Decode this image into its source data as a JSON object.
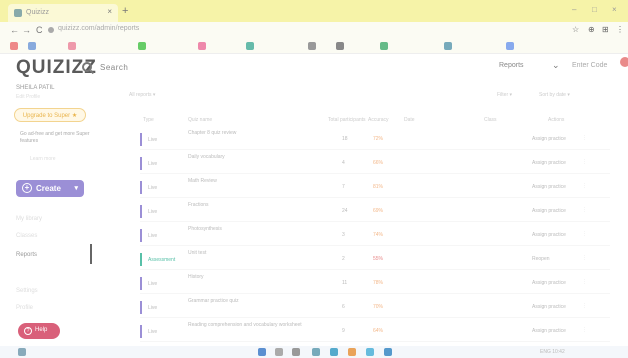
{
  "browser": {
    "tab_title": "Quizizz",
    "tab_close": "×",
    "new_tab": "+",
    "window_controls": [
      "–",
      "□",
      "×"
    ],
    "nav": {
      "back": "←",
      "forward": "→",
      "reload": "C"
    },
    "url": "quizizz.com/admin/reports",
    "address_icons": [
      "☆",
      "⊕",
      "⊞",
      "⋮"
    ]
  },
  "header": {
    "logo": "QUIZIZZ",
    "search_label": "Search",
    "reports_label": "Reports",
    "chevron": "⌄",
    "enter_code": "Enter Code"
  },
  "sidebar": {
    "user_name": "SHEILA PATIL",
    "user_sub": "Edit Profile",
    "upgrade_label": "Upgrade to Super ★",
    "promo_text": "Go ad-free and get more Super features",
    "promo_link": "Learn more",
    "create_label": "Create",
    "create_plus": "+",
    "create_caret": "▾",
    "items": [
      {
        "label": "My library"
      },
      {
        "label": "Classes"
      },
      {
        "label": "Reports"
      },
      {
        "label": "Settings"
      },
      {
        "label": "Profile"
      }
    ],
    "help_label": "Help",
    "help_icon": "?"
  },
  "main": {
    "filter_label": "All reports ▾",
    "filter_right": "Filter ▾",
    "filter_right2": "Sort by date ▾",
    "headers": [
      "Type",
      "Quiz name",
      "Total participants",
      "Accuracy",
      "Date",
      "Class",
      "Actions"
    ],
    "rows": [
      {
        "type": "Live",
        "name": "Chapter 8 quiz review",
        "num": "18",
        "acc": "72%",
        "action": "Assign practice"
      },
      {
        "type": "Live",
        "name": "Daily vocabulary",
        "num": "4",
        "acc": "66%",
        "action": "Assign practice"
      },
      {
        "type": "Live",
        "name": "Math Review",
        "num": "7",
        "acc": "81%",
        "action": "Assign practice"
      },
      {
        "type": "Live",
        "name": "Fractions",
        "num": "24",
        "acc": "69%",
        "action": "Assign practice"
      },
      {
        "type": "Live",
        "name": "Photosynthesis",
        "num": "3",
        "acc": "74%",
        "action": "Assign practice"
      },
      {
        "type": "Assessment",
        "name": "Unit test",
        "num": "2",
        "acc": "55%",
        "action": "Reopen",
        "red": true
      },
      {
        "type": "Live",
        "name": "History",
        "num": "11",
        "acc": "78%",
        "action": "Assign practice"
      },
      {
        "type": "Live",
        "name": "Grammar practice quiz",
        "num": "6",
        "acc": "70%",
        "action": "Assign practice"
      },
      {
        "type": "Live",
        "name": "Reading comprehension and vocabulary worksheet",
        "num": "9",
        "acc": "64%",
        "action": "Assign practice"
      }
    ]
  },
  "taskbar": {
    "tray": "ENG 10:42"
  },
  "colors": {
    "tab_bar": "#f6f3a8",
    "create_button": "#9b8fd6",
    "help_button": "#d9607a",
    "assessment": "#58c0a8",
    "upgrade": "#e9b44c"
  }
}
